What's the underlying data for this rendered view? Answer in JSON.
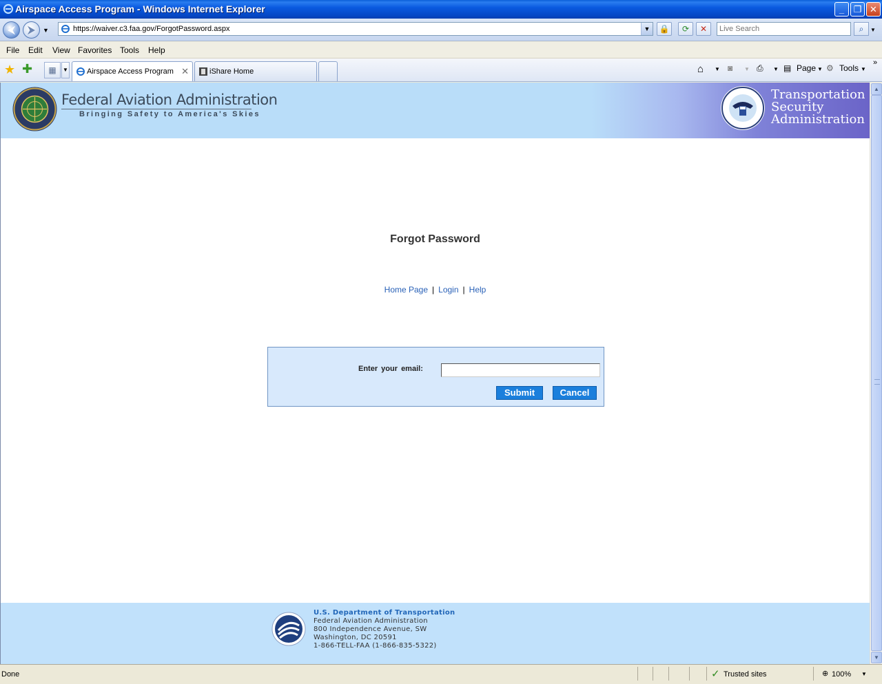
{
  "window": {
    "title": "Airspace Access Program - Windows Internet Explorer"
  },
  "address_bar": {
    "url": "https://waiver.c3.faa.gov/ForgotPassword.aspx",
    "search_placeholder": "Live Search"
  },
  "menu": {
    "items": [
      "File",
      "Edit",
      "View",
      "Favorites",
      "Tools",
      "Help"
    ]
  },
  "tabs": [
    {
      "label": "Airspace Access Program",
      "active": true
    },
    {
      "label": "iShare Home",
      "active": false
    }
  ],
  "command_bar": {
    "page_label": "Page",
    "tools_label": "Tools"
  },
  "header": {
    "faa_title": "Federal Aviation Administration",
    "faa_tagline": "Bringing Safety to America's Skies",
    "tsa_lines": [
      "Transportation",
      "Security",
      "Administration"
    ]
  },
  "page": {
    "title": "Forgot Password",
    "nav_links": [
      "Home Page",
      "Login",
      "Help"
    ],
    "form": {
      "email_label": "Enter your  email:",
      "email_value": "",
      "submit_label": "Submit",
      "cancel_label": "Cancel"
    }
  },
  "footer": {
    "dept": "U.S. Department of Transportation",
    "agency": "Federal Aviation Administration",
    "street": "800 Independence Avenue, SW",
    "city": "Washington, DC 20591",
    "phone": "1-866-TELL-FAA (1-866-835-5322)"
  },
  "status_bar": {
    "status": "Done",
    "zone": "Trusted sites",
    "zoom": "100%"
  },
  "colors": {
    "link": "#2860b7",
    "button": "#1b7fdc",
    "form_bg": "#d8e9fc",
    "header_bg": "#b9ddf9",
    "footer_bg": "#c1e1fb",
    "tsa_purple": "#6b64c8"
  }
}
